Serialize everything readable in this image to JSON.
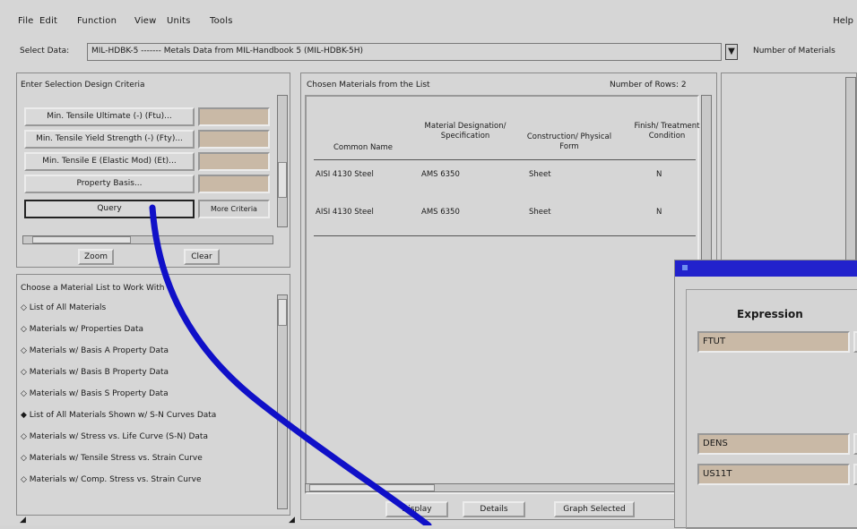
{
  "menu": {
    "items": [
      "File",
      "Edit",
      "Function",
      "View",
      "Units",
      "Tools"
    ],
    "help": "Help"
  },
  "dataset": {
    "label": "Select Data:",
    "value": "MIL-HDBK-5 ------- Metals Data from MIL-Handbook 5 (MIL-HDBK-5H)",
    "dropdown": "▼",
    "right_text": "Number of Materials"
  },
  "criteria": {
    "title": "Enter Selection Design Criteria",
    "buttons": [
      "Min. Tensile Ultimate (-) (Ftu)...",
      "Min. Tensile Yield Strength (-) (Fty)...",
      "Min. Tensile E (Elastic Mod) (Et)...",
      "Property Basis...",
      "Query"
    ],
    "query_side": "More Criteria",
    "zoom_label": "Zoom",
    "clear_label": "Clear"
  },
  "materials": {
    "title": "Choose a Material List to Work With",
    "items": [
      "List of All Materials",
      "Materials w/ Properties Data",
      "Materials w/ Basis A Property Data",
      "Materials w/ Basis B Property Data",
      "Materials w/ Basis S Property Data",
      "List of All Materials Shown w/ S-N Curves Data",
      "Materials w/ Stress vs. Life Curve (S-N) Data",
      "Materials w/ Tensile Stress vs. Strain Curve",
      "Materials w/ Comp. Stress vs. Strain Curve"
    ]
  },
  "results": {
    "title": "Chosen Materials from the List",
    "count_label": "Number of Rows: 2",
    "columns": [
      "Common Name",
      "Material Designation/ Specification",
      "Construction/ Physical Form",
      "Finish/ Treatment Condition"
    ],
    "rows": [
      [
        "AISI 4130 Steel",
        "AMS 6350",
        "Sheet",
        "N"
      ],
      [
        "AISI 4130 Steel",
        "AMS 6350",
        "Sheet",
        "N"
      ]
    ],
    "buttons": [
      "Display",
      "Details",
      "Graph Selected"
    ]
  },
  "expression_dialog": {
    "heading": "Expression",
    "fields": [
      "FTUT",
      "DENS",
      "US11T"
    ]
  },
  "colors": {
    "annotation": "#1010c8",
    "title_bar": "#2222cc",
    "field_tint": "#c9b9a6"
  }
}
